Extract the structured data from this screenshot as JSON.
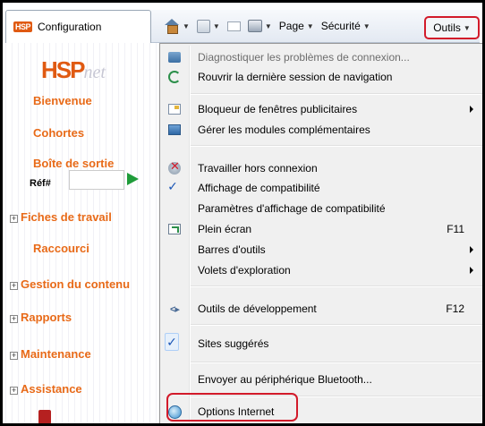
{
  "tab": {
    "badge": "HSP",
    "title": "Configuration"
  },
  "toolbar": {
    "page_label": "Page",
    "security_label": "Sécurité",
    "tools_label": "Outils"
  },
  "sidebar": {
    "logo_main": "HSP",
    "logo_suffix": "net",
    "ref_label": "Réf#",
    "items": [
      {
        "label": "Bienvenue",
        "expandable": false
      },
      {
        "label": "Cohortes",
        "expandable": false
      },
      {
        "label": "Boîte de sortie",
        "expandable": false
      },
      {
        "label": "Fiches de travail",
        "expandable": true
      },
      {
        "label": "Raccourci",
        "expandable": false
      },
      {
        "label": "Gestion du contenu",
        "expandable": true
      },
      {
        "label": "Rapports",
        "expandable": true
      },
      {
        "label": "Maintenance",
        "expandable": true
      },
      {
        "label": "Assistance",
        "expandable": true
      }
    ]
  },
  "menu": {
    "items": [
      {
        "label": "Diagnostiquer les problèmes de connexion...",
        "disabled": true,
        "icon": "diagnose-icon"
      },
      {
        "label": "Rouvrir la dernière session de navigation",
        "icon": "reopen-session-icon"
      },
      {
        "label": "Bloqueur de fenêtres publicitaires",
        "submenu": true,
        "icon": "popup-blocker-icon"
      },
      {
        "label": "Gérer les modules complémentaires",
        "icon": "addons-icon"
      },
      {
        "label": "Travailler hors connexion",
        "icon": "offline-icon"
      },
      {
        "label": "Affichage de compatibilité",
        "checked": true,
        "icon": "check-icon"
      },
      {
        "label": "Paramètres d'affichage de compatibilité"
      },
      {
        "label": "Plein écran",
        "shortcut": "F11",
        "icon": "fullscreen-icon"
      },
      {
        "label": "Barres d'outils",
        "submenu": true
      },
      {
        "label": "Volets d'exploration",
        "submenu": true
      },
      {
        "label": "Outils de développement",
        "shortcut": "F12",
        "icon": "developer-tools-icon"
      },
      {
        "label": "Sites suggérés",
        "checked": true,
        "icon": "check-icon"
      },
      {
        "label": "Envoyer au périphérique Bluetooth..."
      },
      {
        "label": "Options Internet",
        "icon": "internet-options-icon"
      }
    ]
  },
  "colors": {
    "sidebar_link": "#e86a18",
    "highlight_outline": "#d21a2a",
    "menu_background": "#f0f0f0"
  }
}
